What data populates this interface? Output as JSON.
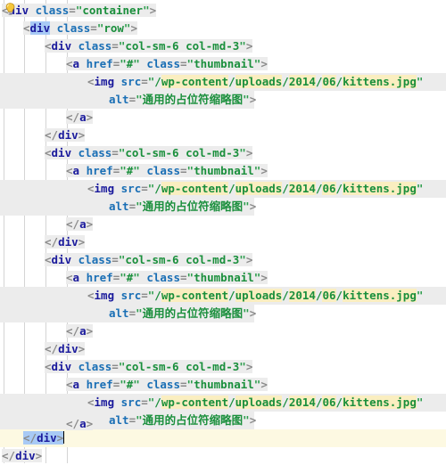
{
  "editor": {
    "kind": "html-source-code-view",
    "language": "HTML",
    "line_height_px": 20,
    "font_weight": "bold",
    "colors": {
      "background": "#ffffff",
      "punctuation": "#8a8a8a",
      "tag_name": "#1a1a9c",
      "attribute_name": "#1a6fb5",
      "string_value": "#1a8f3c",
      "token_background": "#ececec",
      "path_segment_highlight": "#faeec0",
      "matching_tag_highlight": "#a8caf5",
      "current_line_background": "#fdf9e2",
      "indent_guide": "#d4d4d4",
      "caret": "#000000"
    },
    "gutter": {
      "quick_fix_icon": "lightbulb-icon",
      "quick_fix_icon_line": 23
    },
    "indent_guide_x": [
      4,
      27,
      51,
      75
    ],
    "caret_line": 23
  },
  "tokens": {
    "lt": "<",
    "gt": ">",
    "lt_slash": "</",
    "eq": "=",
    "quote": "\"",
    "tag_div": "div",
    "tag_a": "a",
    "tag_img": "img",
    "attr_class": "class",
    "attr_href": "href",
    "attr_src": "src",
    "attr_alt": "alt",
    "val_container": "container",
    "val_row": "row",
    "val_cols": "col-sm-6 col-md-3",
    "val_hash": "#",
    "val_thumbnail": "thumbnail",
    "path_slash": "/",
    "path_wp_content": "wp-content",
    "path_uploads": "uploads",
    "path_2014": "2014",
    "path_06": "06",
    "path_kittens": "kittens.jpg",
    "val_alt_text": "通用的占位符缩略图"
  },
  "code_lines": [
    {
      "n": 1,
      "indent": 0,
      "text": "<div class=\"container\">"
    },
    {
      "n": 2,
      "indent": 1,
      "text": "<div class=\"row\">"
    },
    {
      "n": 3,
      "indent": 2,
      "text": "<div class=\"col-sm-6 col-md-3\">"
    },
    {
      "n": 4,
      "indent": 3,
      "text": "<a href=\"#\" class=\"thumbnail\">"
    },
    {
      "n": 5,
      "indent": 4,
      "text": "<img src=\"/wp-content/uploads/2014/06/kittens.jpg"
    },
    {
      "n": 6,
      "indent": 5,
      "text": "alt=\"通用的占位符缩略图\">"
    },
    {
      "n": 7,
      "indent": 3,
      "text": "</a>"
    },
    {
      "n": 8,
      "indent": 2,
      "text": "</div>"
    },
    {
      "n": 9,
      "indent": 2,
      "text": "<div class=\"col-sm-6 col-md-3\">"
    },
    {
      "n": 10,
      "indent": 3,
      "text": "<a href=\"#\" class=\"thumbnail\">"
    },
    {
      "n": 11,
      "indent": 4,
      "text": "<img src=\"/wp-content/uploads/2014/06/kittens.jpg"
    },
    {
      "n": 12,
      "indent": 5,
      "text": "alt=\"通用的占位符缩略图\">"
    },
    {
      "n": 13,
      "indent": 3,
      "text": "</a>"
    },
    {
      "n": 14,
      "indent": 2,
      "text": "</div>"
    },
    {
      "n": 15,
      "indent": 2,
      "text": "<div class=\"col-sm-6 col-md-3\">"
    },
    {
      "n": 16,
      "indent": 3,
      "text": "<a href=\"#\" class=\"thumbnail\">"
    },
    {
      "n": 17,
      "indent": 4,
      "text": "<img src=\"/wp-content/uploads/2014/06/kittens.jpg"
    },
    {
      "n": 18,
      "indent": 5,
      "text": "alt=\"通用的占位符缩略图\">"
    },
    {
      "n": 19,
      "indent": 3,
      "text": "</a>"
    },
    {
      "n": 20,
      "indent": 2,
      "text": "</div>"
    },
    {
      "n": 21,
      "indent": 2,
      "text": "<div class=\"col-sm-6 col-md-3\">"
    },
    {
      "n": 22,
      "indent": 3,
      "text": "<a href=\"#\" class=\"thumbnail\">"
    },
    {
      "n": 23,
      "indent": 4,
      "text": "<img src=\"/wp-content/uploads/2014/06/kittens.jpg"
    },
    {
      "n": 24,
      "indent": 5,
      "text": "alt=\"通用的占位符缩略图\">"
    },
    {
      "n": 25,
      "indent": 3,
      "text": "</a>"
    },
    {
      "n": 26,
      "indent": 2,
      "text": "</div>"
    },
    {
      "n": 27,
      "indent": 1,
      "text": "</div>"
    },
    {
      "n": 28,
      "indent": 0,
      "text": "</div>"
    }
  ]
}
